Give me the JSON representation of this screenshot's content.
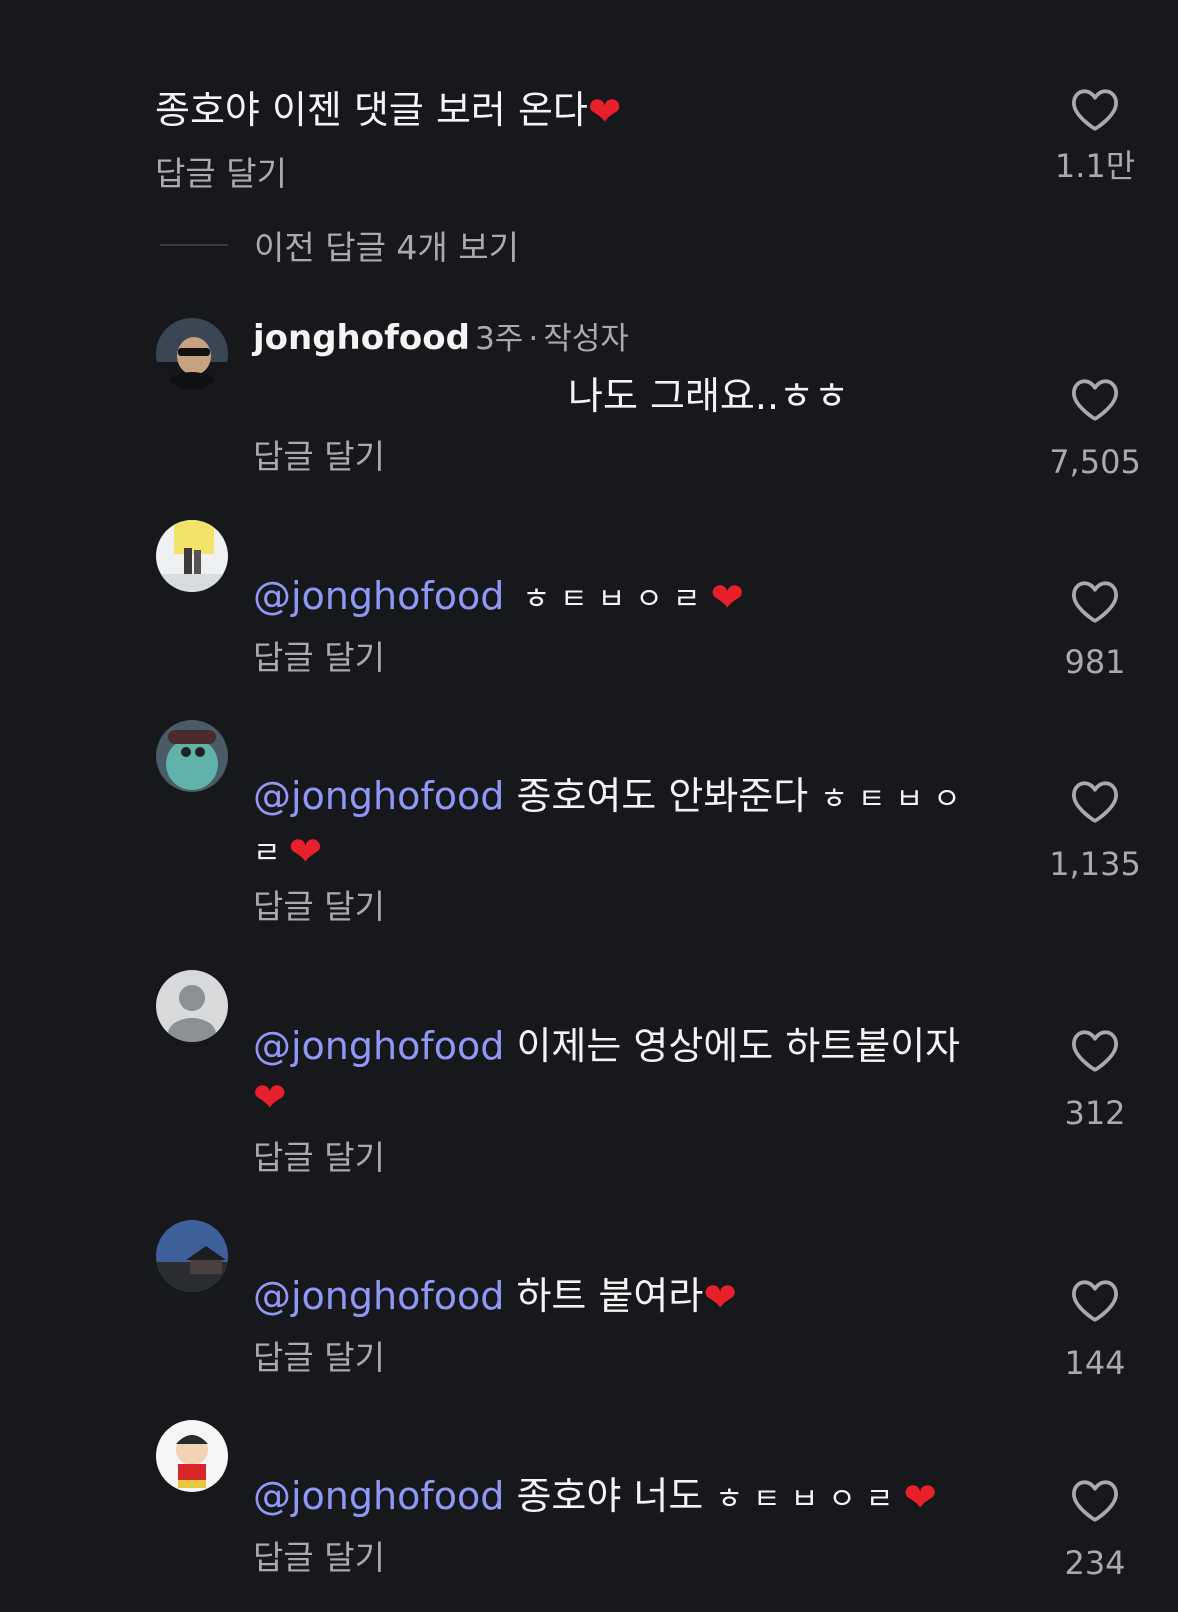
{
  "top_comment": {
    "text": "종호야 이젠 댓글 보러 온다",
    "reply_label": "답글 달기",
    "like_count": "1.1만"
  },
  "view_previous": "이전 답글 4개 보기",
  "replies": [
    {
      "author": "jonghofood",
      "time": "3주",
      "separator": "·",
      "badge": "작성자",
      "text": "나도 그래요..ㅎㅎ",
      "reply_label": "답글 달기",
      "like_count": "7,505"
    },
    {
      "mention": "@jonghofood",
      "text": "ㅎㅌㅂㅇㄹ",
      "reply_label": "답글 달기",
      "like_count": "981"
    },
    {
      "mention": "@jonghofood",
      "text": "종호여도 안봐준다 ",
      "text_jamo": "ㅎㅌㅂㅇ",
      "text_line2": "ㄹ",
      "reply_label": "답글 달기",
      "like_count": "1,135"
    },
    {
      "mention": "@jonghofood",
      "text": "이제는 영상에도 하트붙이자",
      "reply_label": "답글 달기",
      "like_count": "312"
    },
    {
      "mention": "@jonghofood",
      "text": "하트 붙여라",
      "reply_label": "답글 달기",
      "like_count": "144"
    },
    {
      "mention": "@jonghofood",
      "text": "종호야 너도 ",
      "text_jamo": "ㅎㅌㅂㅇㄹ",
      "reply_label": "답글 달기",
      "like_count": "234"
    }
  ],
  "icons": {
    "heart_emoji": "❤️",
    "like": "heart-outline-icon"
  },
  "colors": {
    "background": "#17181c",
    "mention": "#8f98f5",
    "heart": "#e8202b",
    "secondary_text": "#a9a9ae"
  }
}
